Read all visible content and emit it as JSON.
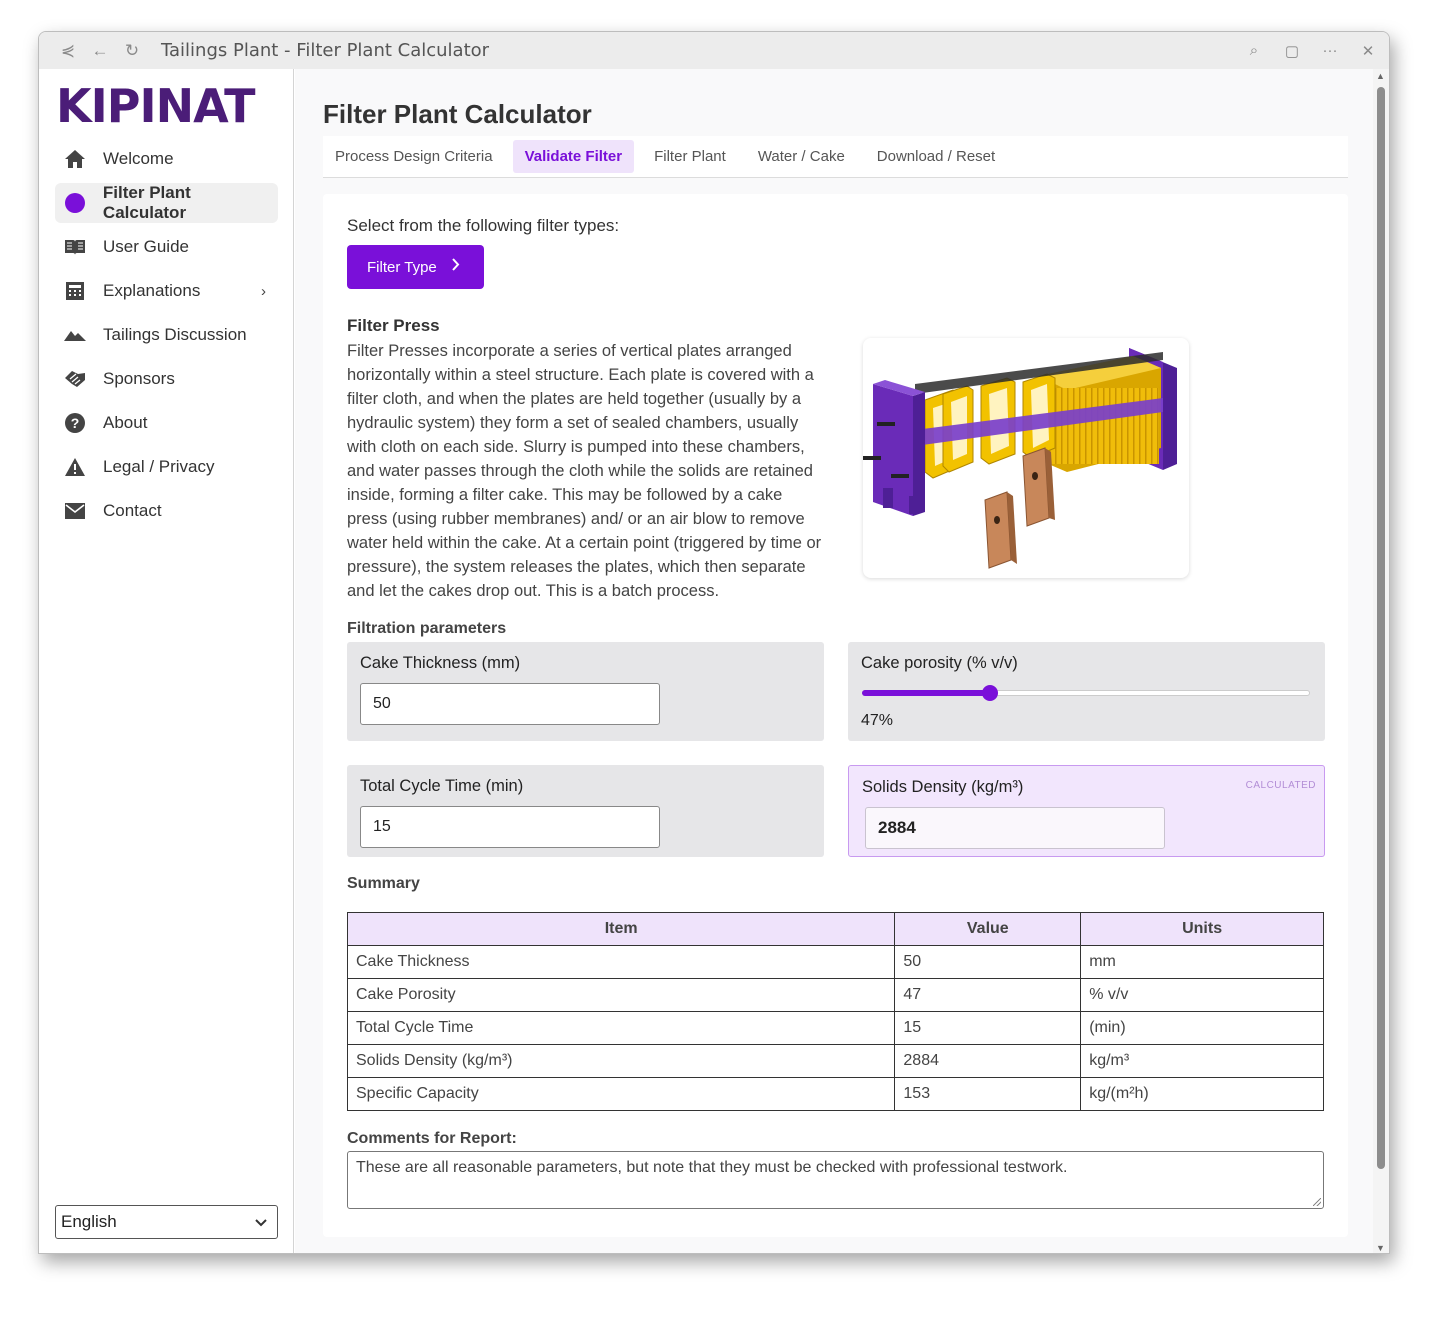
{
  "window": {
    "title": "Tailings Plant - Filter Plant Calculator"
  },
  "sidebar": {
    "logo": "KIPINAT",
    "items": [
      {
        "label": "Welcome",
        "icon": "home-icon"
      },
      {
        "label": "Filter Plant Calculator",
        "icon": "dot-icon",
        "active": true
      },
      {
        "label": "User Guide",
        "icon": "book-icon"
      },
      {
        "label": "Explanations",
        "icon": "calculator-icon",
        "has_submenu": true
      },
      {
        "label": "Tailings Discussion",
        "icon": "mountain-icon"
      },
      {
        "label": "Sponsors",
        "icon": "handshake-icon"
      },
      {
        "label": "About",
        "icon": "help-circle-icon"
      },
      {
        "label": "Legal / Privacy",
        "icon": "warning-icon"
      },
      {
        "label": "Contact",
        "icon": "mail-icon"
      }
    ],
    "language": "English"
  },
  "main": {
    "title": "Filter Plant Calculator",
    "tabs": [
      "Process Design Criteria",
      "Validate Filter",
      "Filter Plant",
      "Water / Cake",
      "Download / Reset"
    ],
    "active_tab": "Validate Filter",
    "select_label": "Select from the following filter types:",
    "filter_button": "Filter Type",
    "filter_heading": "Filter Press",
    "filter_description": "Filter Presses incorporate a series of vertical plates arranged horizontally within a steel structure. Each plate is covered with a filter cloth, and when the plates are held together (usually by a hydraulic system) they form a set of sealed chambers, usually with cloth on each side. Slurry is pumped into these chambers, and water passes through the cloth while the solids are retained inside, forming a filter cake. This may be followed by a cake press (using rubber membranes) and/ or an air blow to remove water held within the cake. At a certain point (triggered by time or pressure), the system releases the plates, which then separate and let the cakes drop out. This is a batch process.",
    "params_label": "Filtration parameters",
    "cake_thickness": {
      "label": "Cake Thickness (mm)",
      "value": "50"
    },
    "cake_porosity": {
      "label": "Cake porosity (% v/v)",
      "value_text": "47%",
      "value": 47
    },
    "cycle_time": {
      "label": "Total Cycle Time (min)",
      "value": "15"
    },
    "solids_density": {
      "label": "Solids Density (kg/m³)",
      "value": "2884",
      "tag": "CALCULATED"
    },
    "summary_label": "Summary",
    "summary": {
      "headers": [
        "Item",
        "Value",
        "Units"
      ],
      "rows": [
        [
          "Cake Thickness",
          "50",
          "mm"
        ],
        [
          "Cake Porosity",
          "47",
          "% v/v"
        ],
        [
          "Total Cycle Time",
          "15",
          "(min)"
        ],
        [
          "Solids Density (kg/m³)",
          "2884",
          "kg/m³"
        ],
        [
          "Specific Capacity",
          "153",
          "kg/(m²h)"
        ]
      ]
    },
    "comments_label": "Comments for Report:",
    "comments": "These are all reasonable parameters, but note that they must be checked with professional testwork."
  },
  "colors": {
    "accent": "#7a10d9",
    "logo": "#4b1d78",
    "calc_bg": "#f2e6fd",
    "press_purple": "#6a2bb8",
    "plate_yellow": "#f2c200",
    "cake_brown": "#c8875a"
  }
}
